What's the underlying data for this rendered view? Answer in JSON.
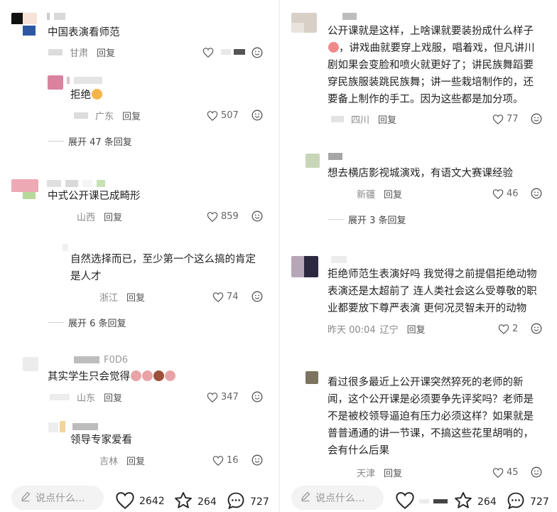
{
  "left": {
    "comments": [
      {
        "text": "中国表演看师范",
        "location": "甘肃",
        "reply": "回复",
        "likes": ""
      },
      {
        "text": "拒绝",
        "location": "广东",
        "reply": "回复",
        "likes": "507"
      },
      {
        "expand": "展开 47 条回复"
      },
      {
        "text": "中式公开课已成畸形",
        "location": "山西",
        "reply": "回复",
        "likes": "859"
      },
      {
        "text_l1": "自然选择而已，至少第一个这么搞的肯定",
        "text_l2": "是人才",
        "location": "浙江",
        "reply": "回复",
        "likes": "74"
      },
      {
        "expand": "展开 6 条回复"
      },
      {
        "username": "F0D6",
        "text": "其实学生只会觉得",
        "location": "山东",
        "reply": "回复",
        "likes": "347"
      },
      {
        "text": "领导专家爱看",
        "location": "吉林",
        "reply": "回复",
        "likes": "16"
      }
    ],
    "bottom": {
      "placeholder": "说点什么...",
      "likes": "2642",
      "stars": "264",
      "comments": "727"
    }
  },
  "right": {
    "comments": [
      {
        "lines": [
          "公开课就是这样，上啥课就要装扮成什么样子",
          "，讲戏曲就要穿上戏服，唱着戏，但凡讲川",
          "剧如果会变脸和喷火就更好了；讲民族舞蹈要",
          "穿民族服装跳民族舞；讲一些栽培制作的，还",
          "要备上制作的手工。因为这些都是加分项。"
        ],
        "location": "四川",
        "reply": "回复",
        "likes": "77"
      },
      {
        "text": "想去横店影视城演戏，有语文大赛课经验",
        "location": "新疆",
        "reply": "回复",
        "likes": "46"
      },
      {
        "expand": "展开 3 条回复"
      },
      {
        "lines": [
          "拒绝师范生表演好吗 我觉得之前提倡拒绝动物",
          "表演还是太超前了 连人类社会这么受尊敬的职",
          "业都要放下尊严表演 更何况灵智未开的动物"
        ],
        "time": "昨天 00:04",
        "location": "辽宁",
        "reply": "回复",
        "likes": "2"
      },
      {
        "lines": [
          "看过很多最近上公开课突然猝死的老师的新",
          "闻，这个公开课是必须要争先评奖吗？老师是",
          "不是被校领导逼迫有压力必须这样？如果就是",
          "普普通通的讲一节课，不搞这些花里胡哨的，",
          "会有什么后果"
        ],
        "location": "天津",
        "reply": "回复",
        "likes": "45"
      }
    ],
    "bottom": {
      "placeholder": "说点什么...",
      "stars": "264",
      "comments": "727"
    }
  },
  "icons": {
    "heart": "heart-icon",
    "smile": "smile-icon",
    "star": "star-icon",
    "comment": "comment-bubble-icon",
    "pen": "pen-icon"
  }
}
